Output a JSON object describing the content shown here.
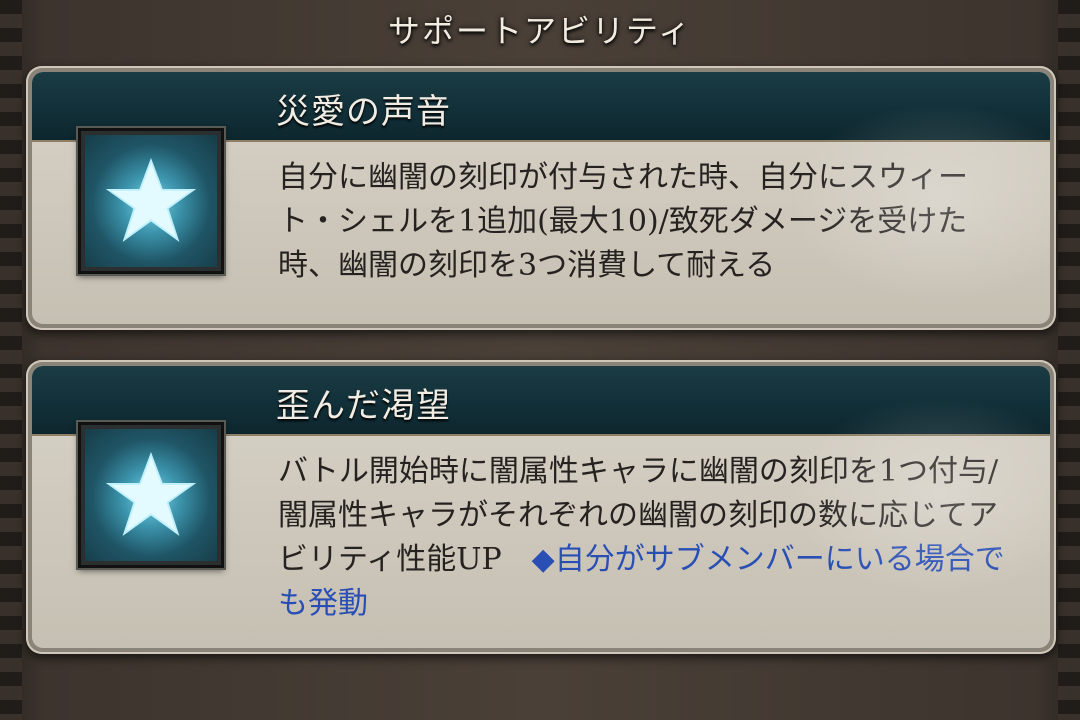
{
  "header": {
    "title": "サポートアビリティ"
  },
  "abilities": [
    {
      "title": "災愛の声音",
      "icon": "star-icon",
      "description": "自分に幽闇の刻印が付与された時、自分にスウィート・シェルを1追加(最大10)/致死ダメージを受けた時、幽闇の刻印を3つ消費して耐える",
      "note": ""
    },
    {
      "title": "歪んだ渇望",
      "icon": "star-icon",
      "description": "バトル開始時に闇属性キャラに幽闇の刻印を1つ付与/闇属性キャラがそれぞれの幽闇の刻印の数に応じてアビリティ性能UP　",
      "note": "◆自分がサブメンバーにいる場合でも発動"
    }
  ],
  "colors": {
    "title_bar": "#123039",
    "panel_body": "#d3cec3",
    "note_text": "#2a4fb4",
    "star": "#dff9ff"
  }
}
